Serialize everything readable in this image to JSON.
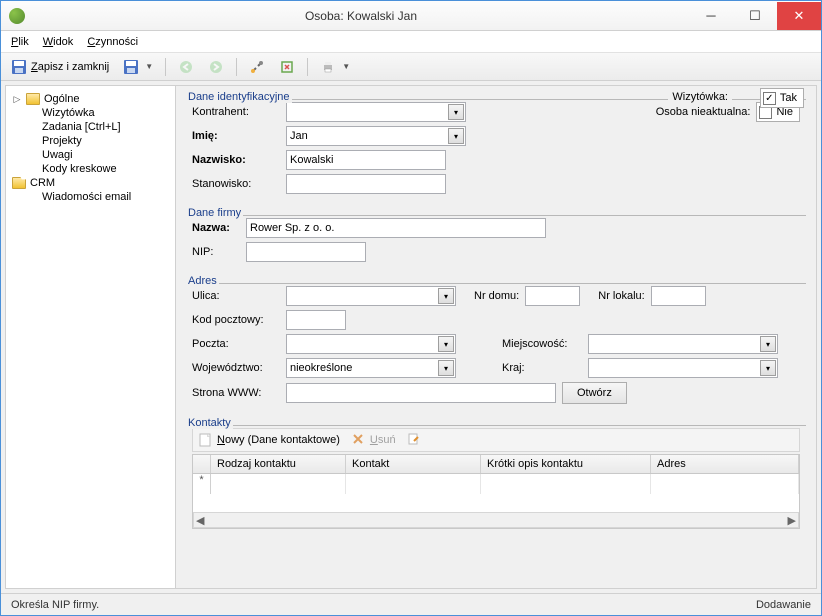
{
  "window": {
    "title": "Osoba: Kowalski Jan"
  },
  "menubar": {
    "file": "Plik",
    "view": "Widok",
    "actions": "Czynności"
  },
  "toolbar": {
    "save_close": "Zapisz i zamknij"
  },
  "nav": {
    "general": "Ogólne",
    "card": "Wizytówka",
    "tasks": "Zadania [Ctrl+L]",
    "projects": "Projekty",
    "notes": "Uwagi",
    "barcodes": "Kody kreskowe",
    "crm": "CRM",
    "emails": "Wiadomości email"
  },
  "identity": {
    "legend": "Dane identyfikacyjne",
    "card_label": "Wizytówka:",
    "card_yes": "Tak",
    "kontrahent_label": "Kontrahent:",
    "kontrahent_value": "",
    "inactive_label": "Osoba nieaktualna:",
    "inactive_no": "Nie",
    "firstname_label": "Imię:",
    "firstname_value": "Jan",
    "lastname_label": "Nazwisko:",
    "lastname_value": "Kowalski",
    "position_label": "Stanowisko:",
    "position_value": ""
  },
  "company": {
    "legend": "Dane firmy",
    "name_label": "Nazwa:",
    "name_value": "Rower Sp. z o. o.",
    "nip_label": "NIP:",
    "nip_value": ""
  },
  "address": {
    "legend": "Adres",
    "street_label": "Ulica:",
    "street_value": "",
    "house_label": "Nr domu:",
    "house_value": "",
    "flat_label": "Nr lokalu:",
    "flat_value": "",
    "postcode_label": "Kod pocztowy:",
    "postcode_value": "",
    "post_label": "Poczta:",
    "post_value": "",
    "city_label": "Miejscowość:",
    "city_value": "",
    "province_label": "Województwo:",
    "province_value": "nieokreślone",
    "country_label": "Kraj:",
    "country_value": "",
    "www_label": "Strona WWW:",
    "www_value": "",
    "open_btn": "Otwórz"
  },
  "contacts": {
    "legend": "Kontakty",
    "new_label": "Nowy (Dane kontaktowe)",
    "delete_label": "Usuń",
    "col_type": "Rodzaj kontaktu",
    "col_contact": "Kontakt",
    "col_desc": "Krótki opis kontaktu",
    "col_addr": "Adres"
  },
  "status": {
    "left": "Określa NIP firmy.",
    "right": "Dodawanie"
  }
}
